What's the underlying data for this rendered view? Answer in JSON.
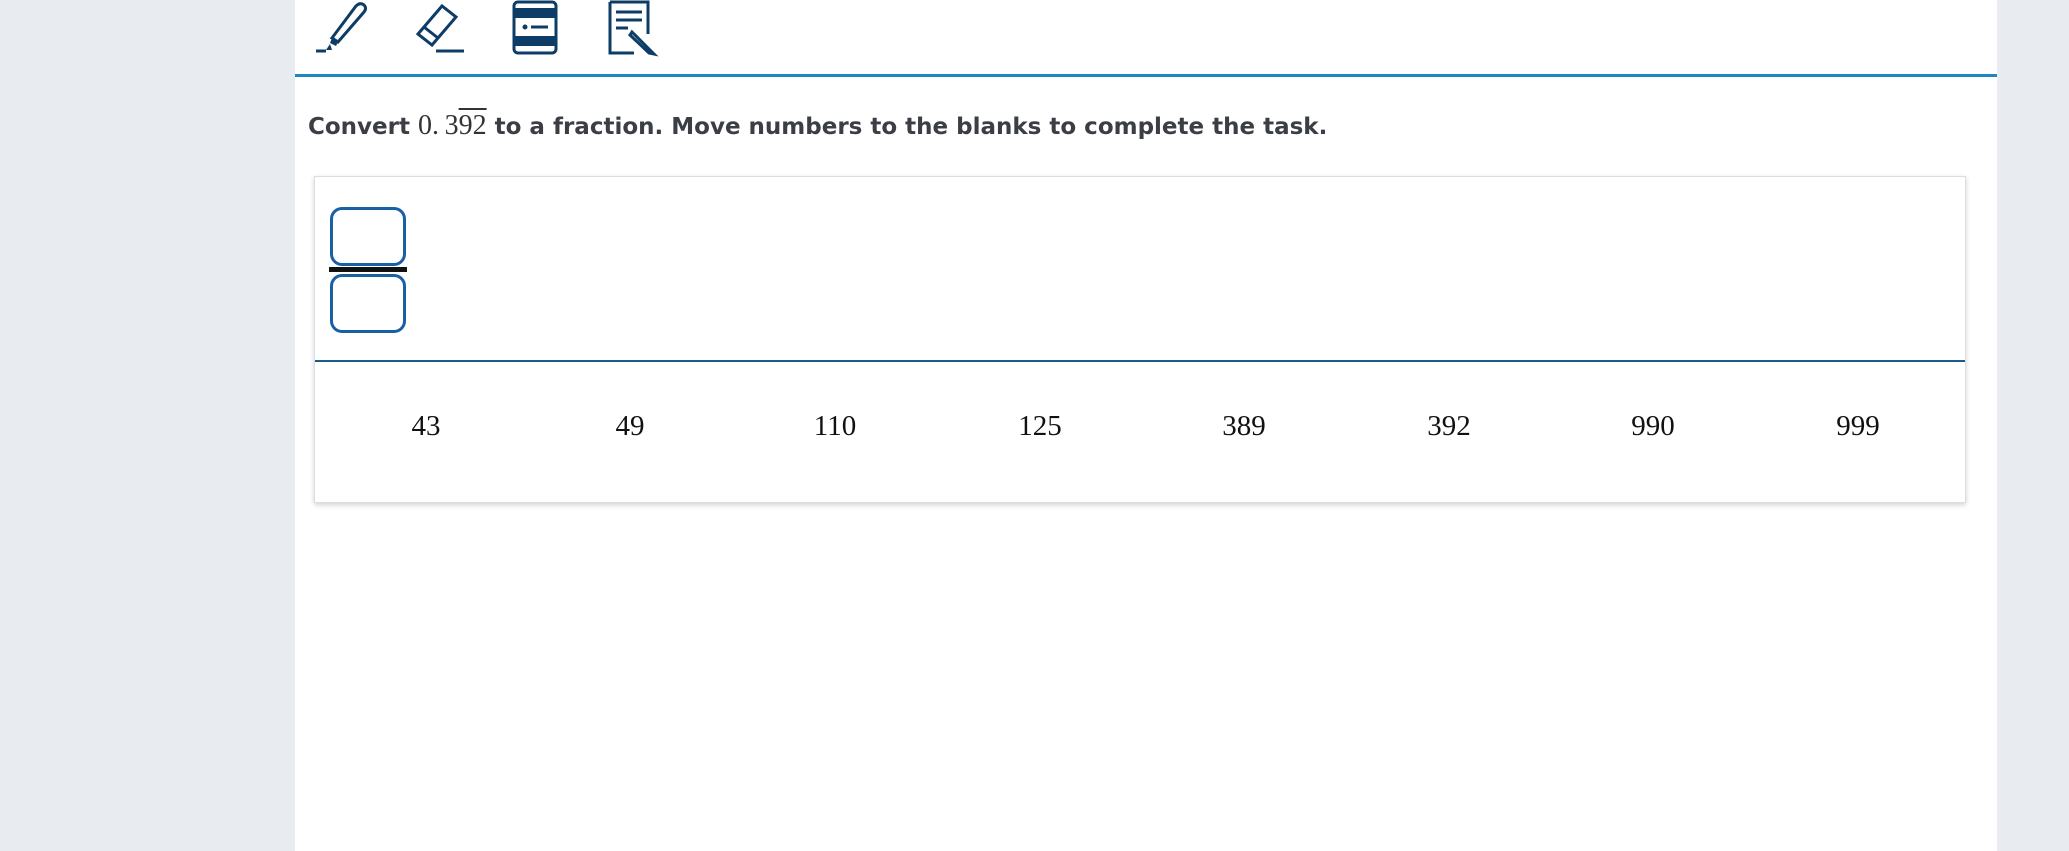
{
  "toolbar": {
    "tools": [
      {
        "name": "highlighter",
        "icon": "highlighter-icon"
      },
      {
        "name": "eraser",
        "icon": "eraser-icon"
      },
      {
        "name": "line-reader",
        "icon": "line-reader-icon"
      },
      {
        "name": "notepad",
        "icon": "notepad-icon"
      }
    ],
    "accent": "#1f87c0",
    "icon_color": "#0d3d66"
  },
  "question": {
    "prefix": "Convert",
    "decimal_whole": "0.",
    "decimal_nonrepeat": "3",
    "decimal_repeat": "92",
    "suffix": "to a fraction. Move numbers to the blanks to complete the task."
  },
  "fraction": {
    "numerator": "",
    "denominator": ""
  },
  "number_bank": [
    "43",
    "49",
    "110",
    "125",
    "389",
    "392",
    "990",
    "999"
  ]
}
